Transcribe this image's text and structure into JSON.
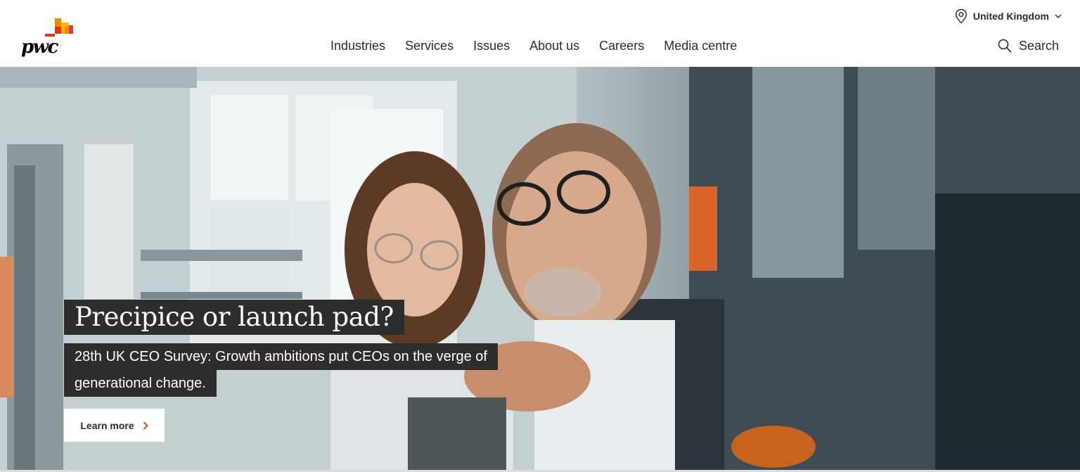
{
  "header": {
    "logo_text": "pwc",
    "nav": [
      {
        "label": "Industries"
      },
      {
        "label": "Services"
      },
      {
        "label": "Issues"
      },
      {
        "label": "About us"
      },
      {
        "label": "Careers"
      },
      {
        "label": "Media centre"
      }
    ],
    "region": {
      "label": "United Kingdom",
      "icon": "location-pin-icon"
    },
    "search": {
      "label": "Search",
      "icon": "search-icon"
    }
  },
  "hero": {
    "headline": "Precipice or launch pad?",
    "subline_1": "28th UK CEO Survey: Growth ambitions put CEOs on the verge of",
    "subline_2": "generational change.",
    "cta_label": "Learn more"
  },
  "colors": {
    "accent_orange": "#e0301e",
    "accent_amber": "#eb8c00",
    "accent_yellow": "#ffb600",
    "text_dark": "#2d2d2d",
    "overlay_dark": "#2d2d2d"
  }
}
